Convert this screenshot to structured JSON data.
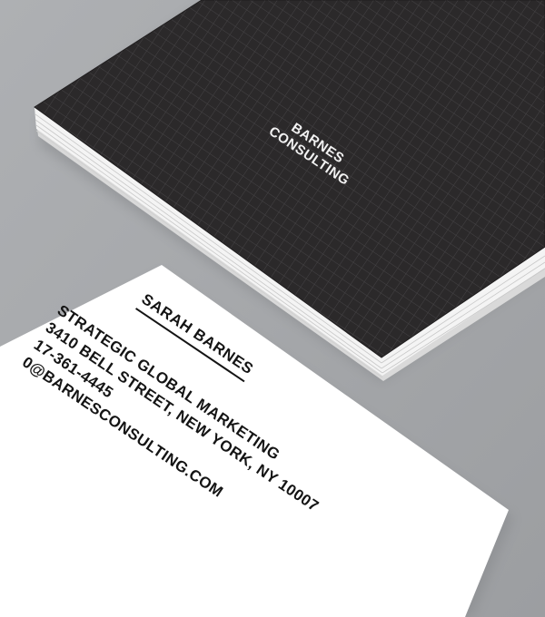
{
  "card_front": {
    "brand_line_1": "BARNES",
    "brand_line_2": "CONSULTING",
    "colors": {
      "card": "#2b292a",
      "grid": "#444244",
      "edge": "#e6e6e6",
      "brand_text": "#f2f2f2"
    }
  },
  "card_back": {
    "name": "SARAH BARNES",
    "title": "STRATEGIC GLOBAL MARKETING",
    "address": "3410 BELL STREET, NEW YORK, NY 10007",
    "phone": "17-361-4445",
    "email": "0@BARNESCONSULTING.COM",
    "colors": {
      "card": "#ffffff",
      "text": "#141414"
    }
  },
  "background_color": "#a5a7aa"
}
